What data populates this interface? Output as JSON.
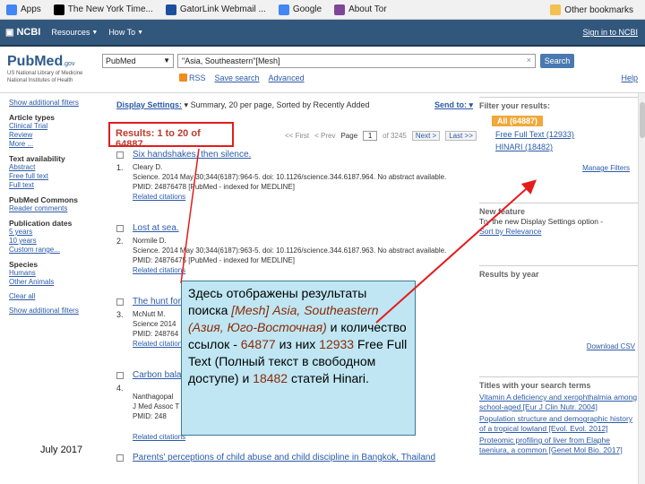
{
  "bookmarks": {
    "items": [
      {
        "label": "Apps",
        "color": "#4285f4"
      },
      {
        "label": "The New York Time...",
        "color": "#000000"
      },
      {
        "label": "GatorLink Webmail ...",
        "color": "#1b4f9c"
      },
      {
        "label": "Google",
        "color": "#4285f4"
      },
      {
        "label": "About Tor",
        "color": "#7d4698"
      }
    ],
    "other": "Other bookmarks"
  },
  "ncbi": {
    "logo": "NCBI",
    "resources": "Resources",
    "howto": "How To",
    "signin": "Sign in to NCBI"
  },
  "pubmed": {
    "logo_pub": "Pub",
    "logo_med": "Med",
    "logo_gov": ".gov",
    "logo_sub1": "US National Library of Medicine",
    "logo_sub2": "National Institutes of Health",
    "db": "PubMed",
    "query": "\"Asia, Southeastern\"[Mesh]",
    "search_btn": "Search",
    "rss": "RSS",
    "save_search": "Save search",
    "advanced": "Advanced",
    "help": "Help"
  },
  "left": {
    "show_filters": "Show additional filters",
    "article_types": "Article types",
    "at_items": [
      "Clinical Trial",
      "Review",
      "More ..."
    ],
    "text_availability": "Text availability",
    "ta_items": [
      "Abstract",
      "Free full text",
      "Full text"
    ],
    "pubmed_commons": "PubMed Commons",
    "pc_items": [
      "Reader comments"
    ],
    "pub_dates": "Publication dates",
    "pd_items": [
      "5 years",
      "10 years",
      "Custom range..."
    ],
    "species": "Species",
    "sp_items": [
      "Humans",
      "Other Animals"
    ],
    "clear_all": "Clear all",
    "show_filters_bottom": "Show additional filters"
  },
  "display": {
    "settings_label": "Display Settings:",
    "settings_value": "Summary, 20 per page, Sorted by Recently Added",
    "send_to": "Send to:"
  },
  "results": {
    "count_label": "Results: 1 to 20 of 64887",
    "first": "<< First",
    "prev": "< Prev",
    "page_label": "Page",
    "page": "1",
    "of": "of 3245",
    "next": "Next >",
    "last": "Last >>"
  },
  "items": [
    {
      "num": "1.",
      "title": "Six handshakes, then silence.",
      "authors": "Cleary D.",
      "citation": "Science. 2014 May 30;344(6187):964-5. doi: 10.1126/science.344.6187.964. No abstract available.",
      "pmid": "PMID: 24876478 [PubMed - indexed for MEDLINE]",
      "related": "Related citations"
    },
    {
      "num": "2.",
      "title": "Lost at sea.",
      "authors": "Normile D.",
      "citation": "Science. 2014 May 30;344(6187):963-5. doi: 10.1126/science.344.6187.963. No abstract available.",
      "pmid": "PMID: 24876475 [PubMed - indexed for MEDLINE]",
      "related": "Related citations"
    },
    {
      "num": "3.",
      "title": "The hunt for",
      "authors": "McNutt M.",
      "citation": "Science 2014",
      "pmid": "PMID: 248764",
      "related": "Related citations"
    },
    {
      "num": "4.",
      "title": "Carbon bala",
      "authors": "Nanthagopal",
      "citation": "J Med Assoc T",
      "pmid": "PMID: 248",
      "related": "Related citations"
    },
    {
      "num": "5.",
      "title": "Parents' perceptions of child abuse and child discipline in Bangkok, Thailand",
      "authors": "",
      "citation": "",
      "pmid": "",
      "related": ""
    }
  ],
  "right": {
    "filter_title": "Filter your results:",
    "all": "All (64887)",
    "free_full_text": "Free Full Text (12933)",
    "hinari": "HINARI (18482)",
    "manage": "Manage Filters",
    "new_feature": "New feature",
    "nf_line1": "Try the new Display Settings option -",
    "nf_line2": "Sort by Relevance",
    "results_by_year": "Results by year",
    "download_csv": "Download CSV",
    "titles_title": "Titles with your search terms",
    "titles": [
      "Vitamin A deficiency and xerophthalmia among school-aged [Eur J Clin Nutr. 2004]",
      "Population structure and demographic history of a tropical lowland [Evol. Evol. 2012]",
      "Proteomic profiling of liver from Elaphe taeniura, a common [Genet Mol Bio. 2017]"
    ]
  },
  "callout": {
    "t1": "Здесь отображены результаты поиска ",
    "t2": "[Mesh] Asia, Southeastern (Азия, Юго-Восточная)",
    "t3": " и количество ссылок - ",
    "n1": "64877",
    "t4": " из них ",
    "n2": "12933",
    "t5": " Free Full Text (Полный текст в свободном доступе) и ",
    "n3": "18482",
    "t6": " статей Hinari."
  },
  "footer": {
    "date": "July 2017"
  },
  "colors": {
    "ncbi_bar": "#32577d",
    "link": "#2b5aa8",
    "highlight_box": "#e41c1c",
    "callout_bg": "#bfe6f2",
    "filter_all_bg": "#f0a83a"
  }
}
